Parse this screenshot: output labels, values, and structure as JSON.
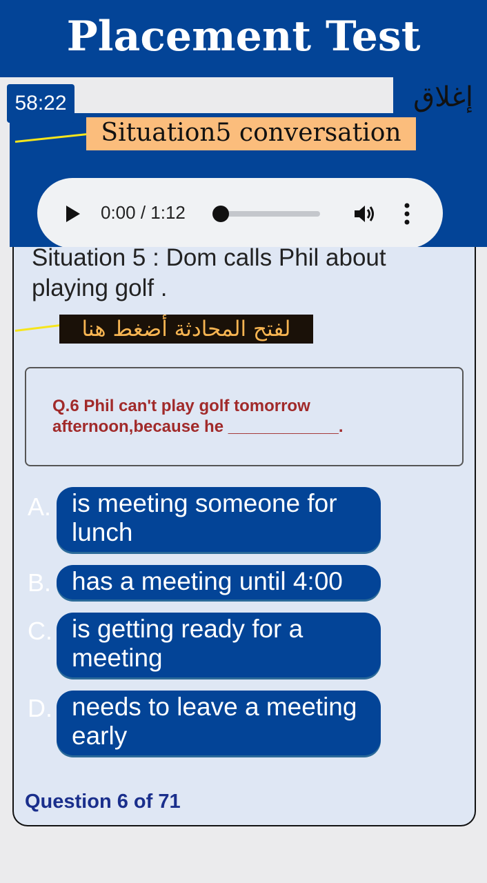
{
  "header": {
    "title": "Placement Test"
  },
  "timer": "58:22",
  "close_label": "إغلاق",
  "situation_label": "Situation5 conversation",
  "player": {
    "time": "0:00 / 1:12",
    "progress": 0.0
  },
  "situation_text": "Situation 5 : Dom calls Phil about playing golf .",
  "open_conversation": "لفتح المحادثة أضغط هنا",
  "question": "Q.6 Phil can't play golf tomorrow afternoon,because he ____________.",
  "options": [
    {
      "letter": "A.",
      "text": "is meeting someone for lunch"
    },
    {
      "letter": "B.",
      "text": "has a meeting until 4:00"
    },
    {
      "letter": "C.",
      "text": "is getting ready for a meeting"
    },
    {
      "letter": "D.",
      "text": "needs to leave a meeting early"
    }
  ],
  "counter": "Question 6 of 71",
  "colors": {
    "brand_blue": "#034497",
    "label_orange": "#fbbd7c",
    "question_red": "#a12a2a",
    "counter_blue": "#1a2f8c"
  }
}
